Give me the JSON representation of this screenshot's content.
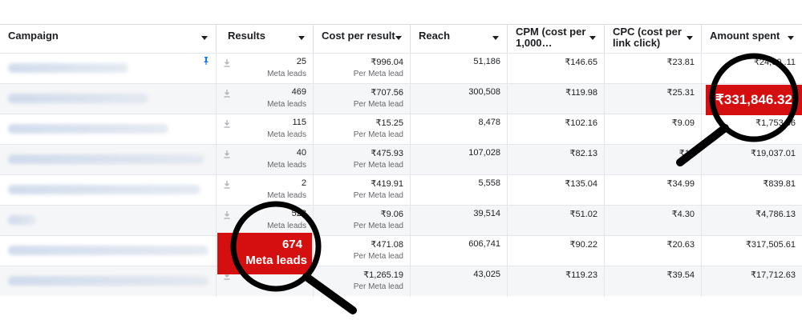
{
  "columns": [
    {
      "label": "Campaign"
    },
    {
      "label": "Results"
    },
    {
      "label": "Cost per result"
    },
    {
      "label": "Reach"
    },
    {
      "label": "CPM (cost per 1,000…"
    },
    {
      "label": "CPC (cost per link click)"
    },
    {
      "label": "Amount spent"
    }
  ],
  "rows": [
    {
      "results": "25",
      "results_sub": "Meta leads",
      "cpr": "₹996.04",
      "cpr_sub": "Per Meta lead",
      "reach": "51,186",
      "cpm": "₹146.65",
      "cpc": "₹23.81",
      "spent": "₹24,90 .11"
    },
    {
      "results": "469",
      "results_sub": "Meta leads",
      "cpr": "₹707.56",
      "cpr_sub": "Per Meta lead",
      "reach": "300,508",
      "cpm": "₹119.98",
      "cpc": "₹25.31",
      "spent": "₹331,846.32"
    },
    {
      "results": "115",
      "results_sub": "Meta leads",
      "cpr": "₹15.25",
      "cpr_sub": "Per Meta lead",
      "reach": "8,478",
      "cpm": "₹102.16",
      "cpc": "₹9.09",
      "spent": "₹1,753.66"
    },
    {
      "results": "40",
      "results_sub": "Meta leads",
      "cpr": "₹475.93",
      "cpr_sub": "Per Meta lead",
      "reach": "107,028",
      "cpm": "₹82.13",
      "cpc": "₹17",
      "spent": "₹19,037.01"
    },
    {
      "results": "2",
      "results_sub": "Meta leads",
      "cpr": "₹419.91",
      "cpr_sub": "Per Meta lead",
      "reach": "5,558",
      "cpm": "₹135.04",
      "cpc": "₹34.99",
      "spent": "₹839.81"
    },
    {
      "results": "528",
      "results_sub": "Meta leads",
      "cpr": "₹9.06",
      "cpr_sub": "Per Meta lead",
      "reach": "39,514",
      "cpm": "₹51.02",
      "cpc": "₹4.30",
      "spent": "₹4,786.13"
    },
    {
      "results": "674",
      "results_sub": "Meta leads",
      "cpr": "₹471.08",
      "cpr_sub": "Per Meta lead",
      "reach": "606,741",
      "cpm": "₹90.22",
      "cpc": "₹20.63",
      "spent": "₹317,505.61"
    },
    {
      "results": "",
      "results_sub": "",
      "cpr": "₹1,265.19",
      "cpr_sub": "Per Meta lead",
      "reach": "43,025",
      "cpm": "₹119.23",
      "cpc": "₹39.54",
      "spent": "₹17,712.63"
    }
  ],
  "highlights": {
    "leads_value": "674",
    "leads_label": "Meta leads",
    "spent_value": "₹331,846.32"
  },
  "colors": {
    "highlight": "#d50f0f",
    "magnifier": "#000000"
  }
}
